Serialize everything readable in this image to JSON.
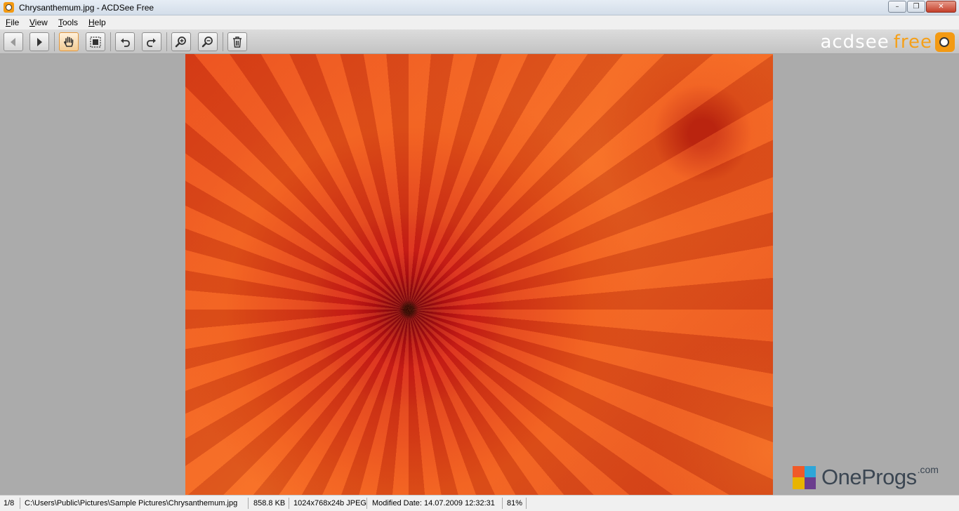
{
  "window": {
    "title": "Chrysanthemum.jpg - ACDSee Free",
    "minimize_glyph": "–",
    "maximize_glyph": "❐",
    "close_glyph": "✕"
  },
  "menu": {
    "items": [
      {
        "label": "File",
        "accel": "F",
        "rest": "ile"
      },
      {
        "label": "View",
        "accel": "V",
        "rest": "iew"
      },
      {
        "label": "Tools",
        "accel": "T",
        "rest": "ools"
      },
      {
        "label": "Help",
        "accel": "H",
        "rest": "elp"
      }
    ]
  },
  "toolbar": {
    "buttons": [
      {
        "name": "previous",
        "icon": "arrow-left-icon",
        "state": "disabled"
      },
      {
        "name": "next",
        "icon": "arrow-right-icon",
        "state": "normal"
      },
      {
        "name": "pan",
        "icon": "hand-icon",
        "state": "active"
      },
      {
        "name": "select",
        "icon": "selection-icon",
        "state": "normal"
      },
      {
        "name": "rotate-left",
        "icon": "rotate-left-icon",
        "state": "normal"
      },
      {
        "name": "rotate-right",
        "icon": "rotate-right-icon",
        "state": "normal"
      },
      {
        "name": "zoom-in",
        "icon": "zoom-in-icon",
        "state": "normal"
      },
      {
        "name": "zoom-out",
        "icon": "zoom-out-icon",
        "state": "normal"
      },
      {
        "name": "delete",
        "icon": "trash-icon",
        "state": "normal"
      }
    ]
  },
  "logo": {
    "word1": "acdsee",
    "word2": "free",
    "colors": {
      "word1": "#ffffff",
      "word2": "#f5a01a"
    }
  },
  "image": {
    "filename": "Chrysanthemum.jpg",
    "subject": "orange chrysanthemum"
  },
  "watermark": {
    "text": "OneProgs",
    "suffix": ".com"
  },
  "status": {
    "index": "1/8",
    "path": "C:\\Users\\Public\\Pictures\\Sample Pictures\\Chrysanthemum.jpg",
    "size": "858.8 KB",
    "dimensions": "1024x768x24b JPEG",
    "modified": "Modified Date: 14.07.2009 12:32:31",
    "zoom": "81%"
  },
  "colors": {
    "viewer_background": "#ababab",
    "active_button": "#f3cc94"
  }
}
